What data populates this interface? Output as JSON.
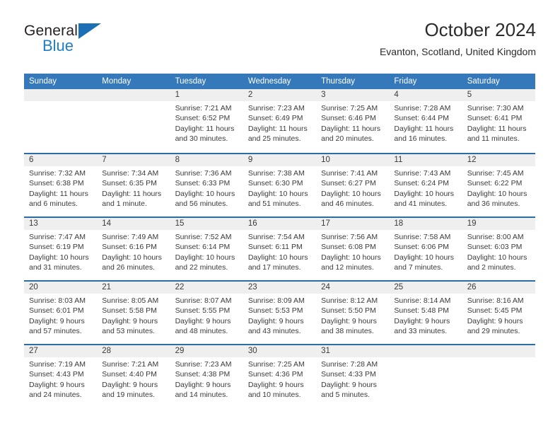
{
  "brand": {
    "name_part1": "General",
    "name_part2": "Blue",
    "flag_icon": "triangle-flag-icon",
    "colors": {
      "blue": "#1a6fb5",
      "text": "#231f20"
    }
  },
  "header": {
    "month_title": "October 2024",
    "location": "Evanton, Scotland, United Kingdom"
  },
  "calendar": {
    "accent_color": "#3579bb",
    "row_border_color": "#2e6da4",
    "number_band_color": "#efefef",
    "day_headers": [
      "Sunday",
      "Monday",
      "Tuesday",
      "Wednesday",
      "Thursday",
      "Friday",
      "Saturday"
    ],
    "weeks": [
      [
        {
          "day": "",
          "empty": true
        },
        {
          "day": "",
          "empty": true
        },
        {
          "day": "1",
          "sunrise": "Sunrise: 7:21 AM",
          "sunset": "Sunset: 6:52 PM",
          "daylight": "Daylight: 11 hours and 30 minutes."
        },
        {
          "day": "2",
          "sunrise": "Sunrise: 7:23 AM",
          "sunset": "Sunset: 6:49 PM",
          "daylight": "Daylight: 11 hours and 25 minutes."
        },
        {
          "day": "3",
          "sunrise": "Sunrise: 7:25 AM",
          "sunset": "Sunset: 6:46 PM",
          "daylight": "Daylight: 11 hours and 20 minutes."
        },
        {
          "day": "4",
          "sunrise": "Sunrise: 7:28 AM",
          "sunset": "Sunset: 6:44 PM",
          "daylight": "Daylight: 11 hours and 16 minutes."
        },
        {
          "day": "5",
          "sunrise": "Sunrise: 7:30 AM",
          "sunset": "Sunset: 6:41 PM",
          "daylight": "Daylight: 11 hours and 11 minutes."
        }
      ],
      [
        {
          "day": "6",
          "sunrise": "Sunrise: 7:32 AM",
          "sunset": "Sunset: 6:38 PM",
          "daylight": "Daylight: 11 hours and 6 minutes."
        },
        {
          "day": "7",
          "sunrise": "Sunrise: 7:34 AM",
          "sunset": "Sunset: 6:35 PM",
          "daylight": "Daylight: 11 hours and 1 minute."
        },
        {
          "day": "8",
          "sunrise": "Sunrise: 7:36 AM",
          "sunset": "Sunset: 6:33 PM",
          "daylight": "Daylight: 10 hours and 56 minutes."
        },
        {
          "day": "9",
          "sunrise": "Sunrise: 7:38 AM",
          "sunset": "Sunset: 6:30 PM",
          "daylight": "Daylight: 10 hours and 51 minutes."
        },
        {
          "day": "10",
          "sunrise": "Sunrise: 7:41 AM",
          "sunset": "Sunset: 6:27 PM",
          "daylight": "Daylight: 10 hours and 46 minutes."
        },
        {
          "day": "11",
          "sunrise": "Sunrise: 7:43 AM",
          "sunset": "Sunset: 6:24 PM",
          "daylight": "Daylight: 10 hours and 41 minutes."
        },
        {
          "day": "12",
          "sunrise": "Sunrise: 7:45 AM",
          "sunset": "Sunset: 6:22 PM",
          "daylight": "Daylight: 10 hours and 36 minutes."
        }
      ],
      [
        {
          "day": "13",
          "sunrise": "Sunrise: 7:47 AM",
          "sunset": "Sunset: 6:19 PM",
          "daylight": "Daylight: 10 hours and 31 minutes."
        },
        {
          "day": "14",
          "sunrise": "Sunrise: 7:49 AM",
          "sunset": "Sunset: 6:16 PM",
          "daylight": "Daylight: 10 hours and 26 minutes."
        },
        {
          "day": "15",
          "sunrise": "Sunrise: 7:52 AM",
          "sunset": "Sunset: 6:14 PM",
          "daylight": "Daylight: 10 hours and 22 minutes."
        },
        {
          "day": "16",
          "sunrise": "Sunrise: 7:54 AM",
          "sunset": "Sunset: 6:11 PM",
          "daylight": "Daylight: 10 hours and 17 minutes."
        },
        {
          "day": "17",
          "sunrise": "Sunrise: 7:56 AM",
          "sunset": "Sunset: 6:08 PM",
          "daylight": "Daylight: 10 hours and 12 minutes."
        },
        {
          "day": "18",
          "sunrise": "Sunrise: 7:58 AM",
          "sunset": "Sunset: 6:06 PM",
          "daylight": "Daylight: 10 hours and 7 minutes."
        },
        {
          "day": "19",
          "sunrise": "Sunrise: 8:00 AM",
          "sunset": "Sunset: 6:03 PM",
          "daylight": "Daylight: 10 hours and 2 minutes."
        }
      ],
      [
        {
          "day": "20",
          "sunrise": "Sunrise: 8:03 AM",
          "sunset": "Sunset: 6:01 PM",
          "daylight": "Daylight: 9 hours and 57 minutes."
        },
        {
          "day": "21",
          "sunrise": "Sunrise: 8:05 AM",
          "sunset": "Sunset: 5:58 PM",
          "daylight": "Daylight: 9 hours and 53 minutes."
        },
        {
          "day": "22",
          "sunrise": "Sunrise: 8:07 AM",
          "sunset": "Sunset: 5:55 PM",
          "daylight": "Daylight: 9 hours and 48 minutes."
        },
        {
          "day": "23",
          "sunrise": "Sunrise: 8:09 AM",
          "sunset": "Sunset: 5:53 PM",
          "daylight": "Daylight: 9 hours and 43 minutes."
        },
        {
          "day": "24",
          "sunrise": "Sunrise: 8:12 AM",
          "sunset": "Sunset: 5:50 PM",
          "daylight": "Daylight: 9 hours and 38 minutes."
        },
        {
          "day": "25",
          "sunrise": "Sunrise: 8:14 AM",
          "sunset": "Sunset: 5:48 PM",
          "daylight": "Daylight: 9 hours and 33 minutes."
        },
        {
          "day": "26",
          "sunrise": "Sunrise: 8:16 AM",
          "sunset": "Sunset: 5:45 PM",
          "daylight": "Daylight: 9 hours and 29 minutes."
        }
      ],
      [
        {
          "day": "27",
          "sunrise": "Sunrise: 7:19 AM",
          "sunset": "Sunset: 4:43 PM",
          "daylight": "Daylight: 9 hours and 24 minutes."
        },
        {
          "day": "28",
          "sunrise": "Sunrise: 7:21 AM",
          "sunset": "Sunset: 4:40 PM",
          "daylight": "Daylight: 9 hours and 19 minutes."
        },
        {
          "day": "29",
          "sunrise": "Sunrise: 7:23 AM",
          "sunset": "Sunset: 4:38 PM",
          "daylight": "Daylight: 9 hours and 14 minutes."
        },
        {
          "day": "30",
          "sunrise": "Sunrise: 7:25 AM",
          "sunset": "Sunset: 4:36 PM",
          "daylight": "Daylight: 9 hours and 10 minutes."
        },
        {
          "day": "31",
          "sunrise": "Sunrise: 7:28 AM",
          "sunset": "Sunset: 4:33 PM",
          "daylight": "Daylight: 9 hours and 5 minutes."
        },
        {
          "day": "",
          "empty": true
        },
        {
          "day": "",
          "empty": true
        }
      ]
    ]
  }
}
